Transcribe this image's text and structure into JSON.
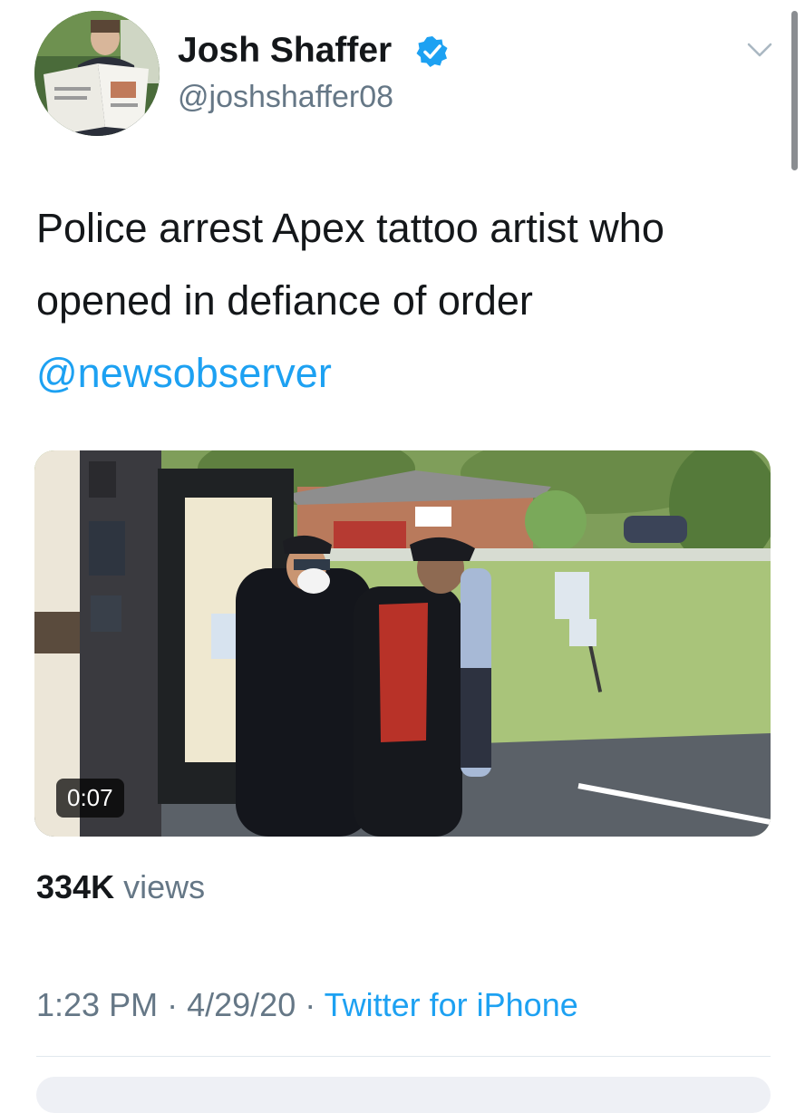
{
  "tweet": {
    "author": {
      "display_name": "Josh Shaffer",
      "handle": "@joshshaffer08",
      "verified": true
    },
    "text": "Police arrest Apex tattoo artist who opened in defiance of order",
    "mention": "@newsobserver",
    "media": {
      "type": "video",
      "duration": "0:07"
    },
    "views_count": "334K",
    "views_label": "views",
    "time": "1:23 PM",
    "separator": "·",
    "date": "4/29/20",
    "source": "Twitter for iPhone"
  },
  "colors": {
    "accent": "#1da1f2",
    "text": "#14171a",
    "secondary": "#657786",
    "divider": "#e1e8ed"
  },
  "icons": [
    "verified-badge-icon",
    "chevron-down-icon"
  ]
}
